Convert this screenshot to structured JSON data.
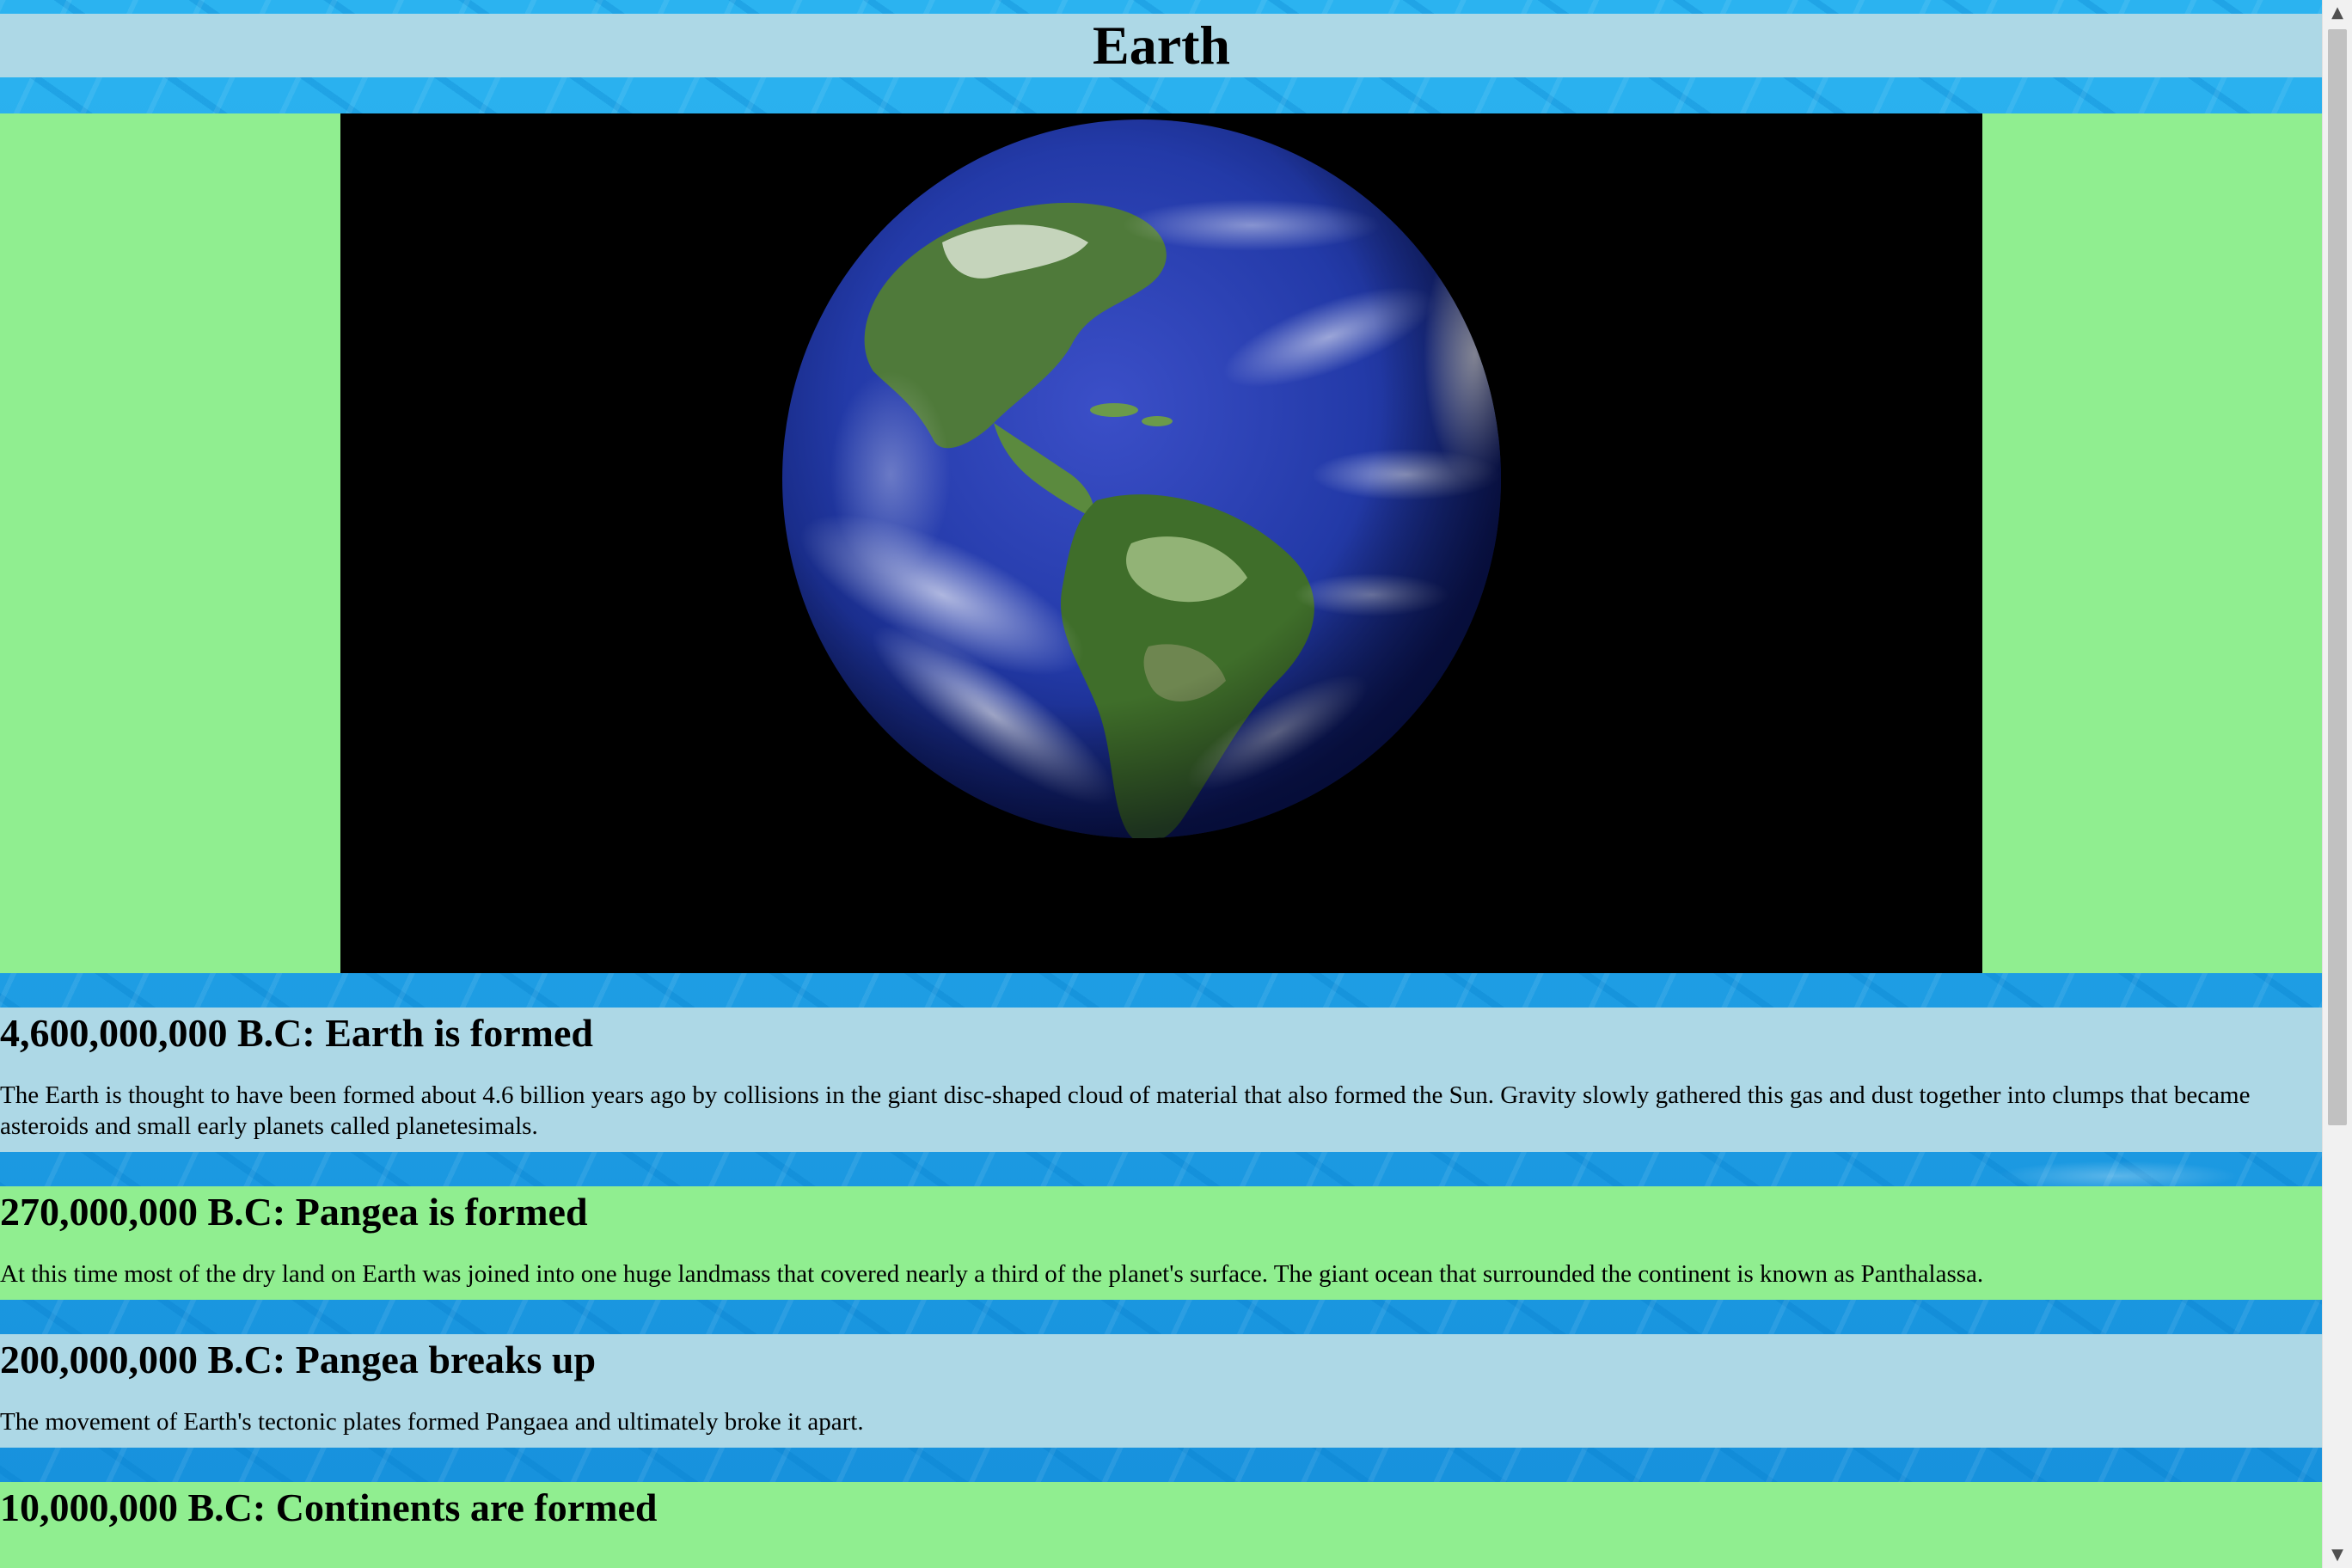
{
  "page": {
    "title": "Earth"
  },
  "hero_image": {
    "alt": "Earth"
  },
  "timeline": [
    {
      "heading": "4,600,000,000 B.C: Earth is formed",
      "text": "The Earth is thought to have been formed about 4.6 billion years ago by collisions in the giant disc-shaped cloud of material that also formed the Sun. Gravity slowly gathered this gas and dust together into clumps that became asteroids and small early planets called planetesimals."
    },
    {
      "heading": "270,000,000 B.C: Pangea is formed",
      "text": "At this time most of the dry land on Earth was joined into one huge landmass that covered nearly a third of the planet's surface. The giant ocean that surrounded the continent is known as Panthalassa."
    },
    {
      "heading": "200,000,000 B.C: Pangea breaks up",
      "text": "The movement of Earth's tectonic plates formed Pangaea and ultimately broke it apart."
    },
    {
      "heading": "10,000,000 B.C: Continents are formed",
      "text": ""
    }
  ],
  "scrollbar": {
    "up_icon": "▲",
    "down_icon": "▼",
    "position_fraction": 0
  },
  "colors": {
    "blue_band": "#add8e6",
    "green_band": "#90ee90",
    "water": "#1a9ae0"
  }
}
